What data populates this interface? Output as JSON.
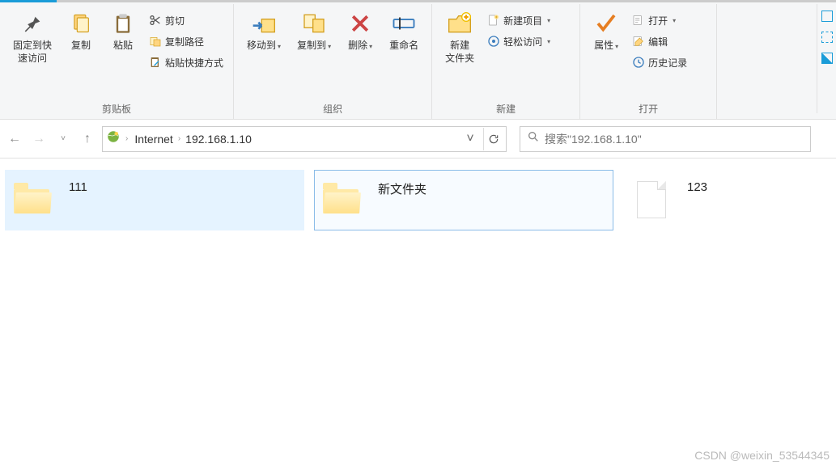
{
  "ribbon": {
    "groups": {
      "clipboard": {
        "label": "剪贴板",
        "pin": "固定到快\n速访问",
        "copy": "复制",
        "paste": "粘贴",
        "cut": "剪切",
        "copyPath": "复制路径",
        "pasteShortcut": "粘贴快捷方式"
      },
      "organize": {
        "label": "组织",
        "moveTo": "移动到",
        "copyTo": "复制到",
        "delete": "删除",
        "rename": "重命名"
      },
      "new": {
        "label": "新建",
        "newFolder": "新建\n文件夹",
        "newItem": "新建项目",
        "easyAccess": "轻松访问"
      },
      "open": {
        "label": "打开",
        "properties": "属性",
        "open": "打开",
        "edit": "编辑",
        "history": "历史记录"
      }
    }
  },
  "address": {
    "segments": [
      "Internet",
      "192.168.1.10"
    ]
  },
  "search": {
    "placeholder": "搜索\"192.168.1.10\""
  },
  "items": [
    {
      "name": "111",
      "type": "folder",
      "state": "sel-light"
    },
    {
      "name": "新文件夹",
      "type": "folder",
      "state": "sel-border"
    },
    {
      "name": "123",
      "type": "file",
      "state": ""
    }
  ],
  "watermark": "CSDN @weixin_53544345"
}
